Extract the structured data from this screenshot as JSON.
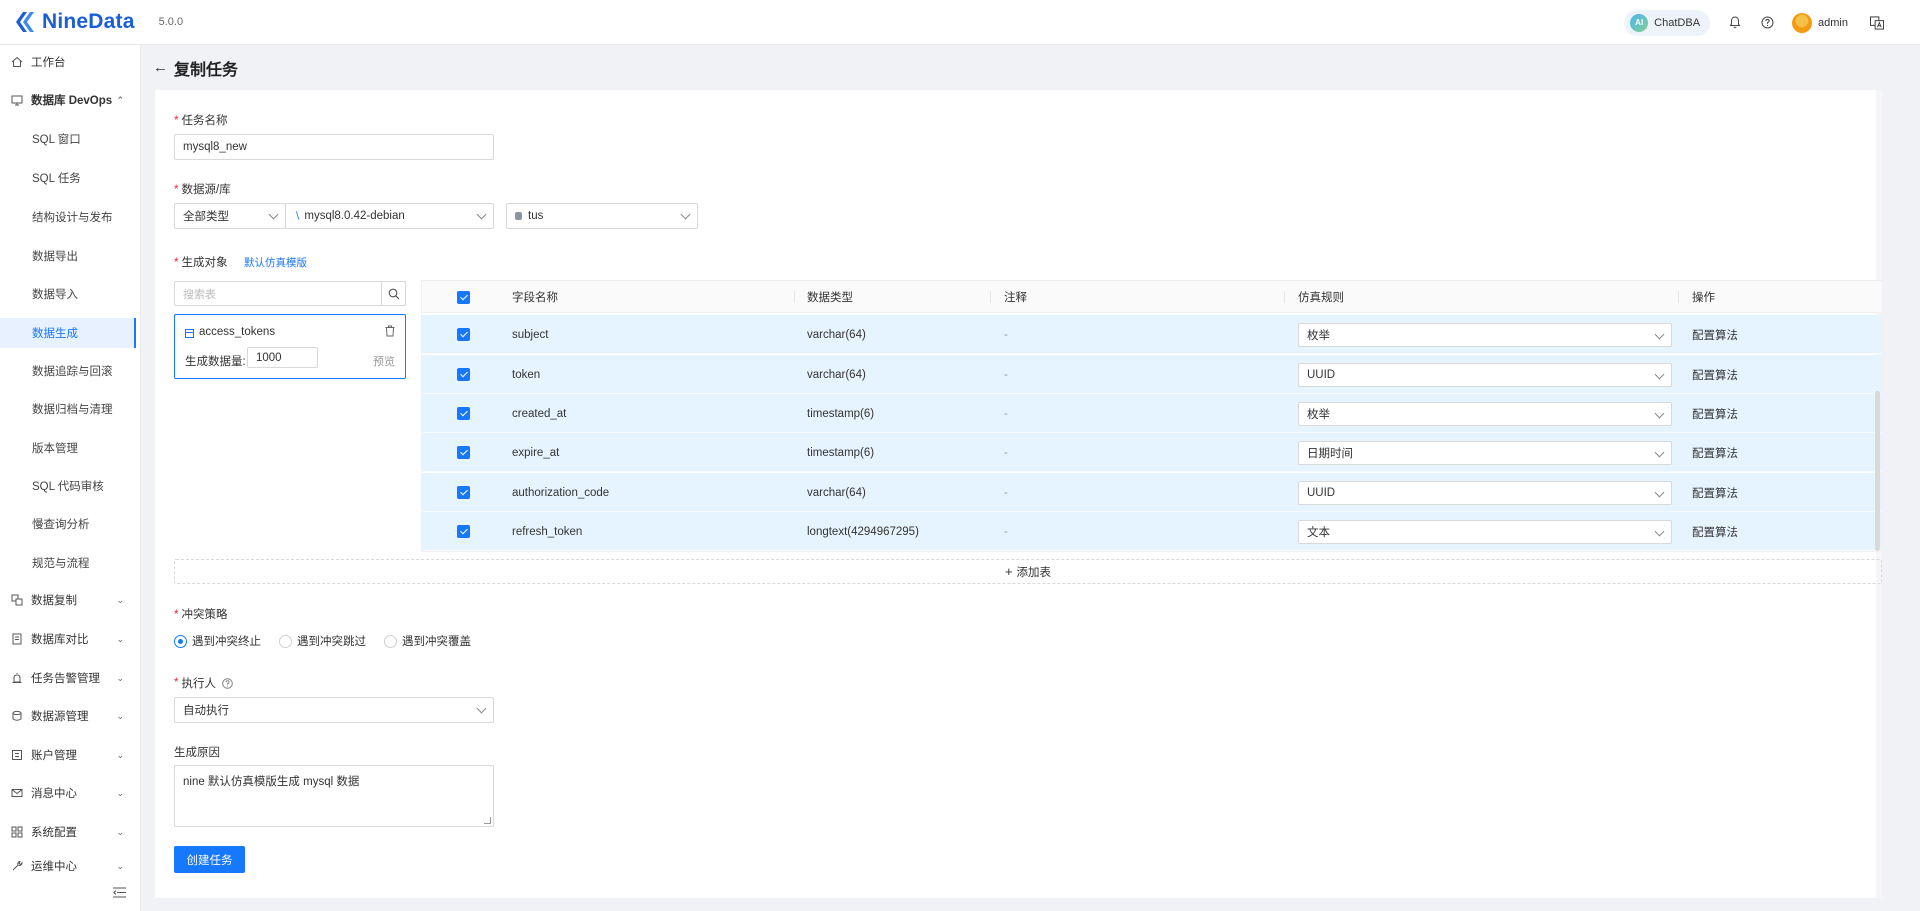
{
  "header": {
    "brand": "NineData",
    "version": "5.0.0",
    "chatdba_badge": "AI",
    "chatdba_label": "ChatDBA",
    "user": "admin"
  },
  "sidebar": {
    "workbench": "工作台",
    "devops": "数据库 DevOps",
    "devops_items": [
      "SQL 窗口",
      "SQL 任务",
      "结构设计与发布",
      "数据导出",
      "数据导入",
      "数据生成",
      "数据追踪与回滚",
      "数据归档与清理",
      "版本管理",
      "SQL 代码审核",
      "慢查询分析",
      "规范与流程"
    ],
    "active_item": "数据生成",
    "groups": [
      "数据复制",
      "数据库对比",
      "任务告警管理",
      "数据源管理",
      "账户管理",
      "消息中心",
      "系统配置",
      "运维中心"
    ]
  },
  "page": {
    "title": "复制任务"
  },
  "form": {
    "task_name_label": "任务名称",
    "task_name_value": "mysql8_new",
    "datasource_label": "数据源/库",
    "type_select": "全部类型",
    "datasource_select": "mysql8.0.42-debian",
    "database_select": "tus",
    "target_label": "生成对象",
    "template_link": "默认仿真模版",
    "search_placeholder": "搜索表",
    "table_name": "access_tokens",
    "gen_count_label": "生成数据量:",
    "gen_count_value": "1000",
    "preview_link": "预览",
    "add_table": "添加表",
    "conflict_label": "冲突策略",
    "conflict_options": [
      "遇到冲突终止",
      "遇到冲突跳过",
      "遇到冲突覆盖"
    ],
    "conflict_selected": "遇到冲突终止",
    "executor_label": "执行人",
    "executor_value": "自动执行",
    "reason_label": "生成原因",
    "reason_value": "nine 默认仿真模版生成 mysql 数据",
    "submit_label": "创建任务"
  },
  "grid": {
    "headers": {
      "field": "字段名称",
      "type": "数据类型",
      "comment": "注释",
      "rule": "仿真规则",
      "action": "操作"
    },
    "rows": [
      {
        "field": "subject",
        "type": "varchar(64)",
        "comment": "-",
        "rule": "枚举",
        "action": "配置算法"
      },
      {
        "field": "token",
        "type": "varchar(64)",
        "comment": "-",
        "rule": "UUID",
        "action": "配置算法"
      },
      {
        "field": "created_at",
        "type": "timestamp(6)",
        "comment": "-",
        "rule": "枚举",
        "action": "配置算法"
      },
      {
        "field": "expire_at",
        "type": "timestamp(6)",
        "comment": "-",
        "rule": "日期时间",
        "action": "配置算法"
      },
      {
        "field": "authorization_code",
        "type": "varchar(64)",
        "comment": "-",
        "rule": "UUID",
        "action": "配置算法"
      },
      {
        "field": "refresh_token",
        "type": "longtext(4294967295)",
        "comment": "-",
        "rule": "文本",
        "action": "配置算法"
      }
    ]
  },
  "colors": {
    "brand": "#1b5fd6",
    "primary": "#1677ff",
    "row_selected": "#e6f4ff",
    "required": "#f5222d"
  },
  "icons": [
    "logo-icon",
    "bell-icon",
    "help-icon",
    "language-icon",
    "home-icon",
    "database-icon",
    "search-icon",
    "delete-icon",
    "table-icon",
    "plus-icon",
    "back-arrow-icon",
    "collapse-sidebar-icon"
  ]
}
